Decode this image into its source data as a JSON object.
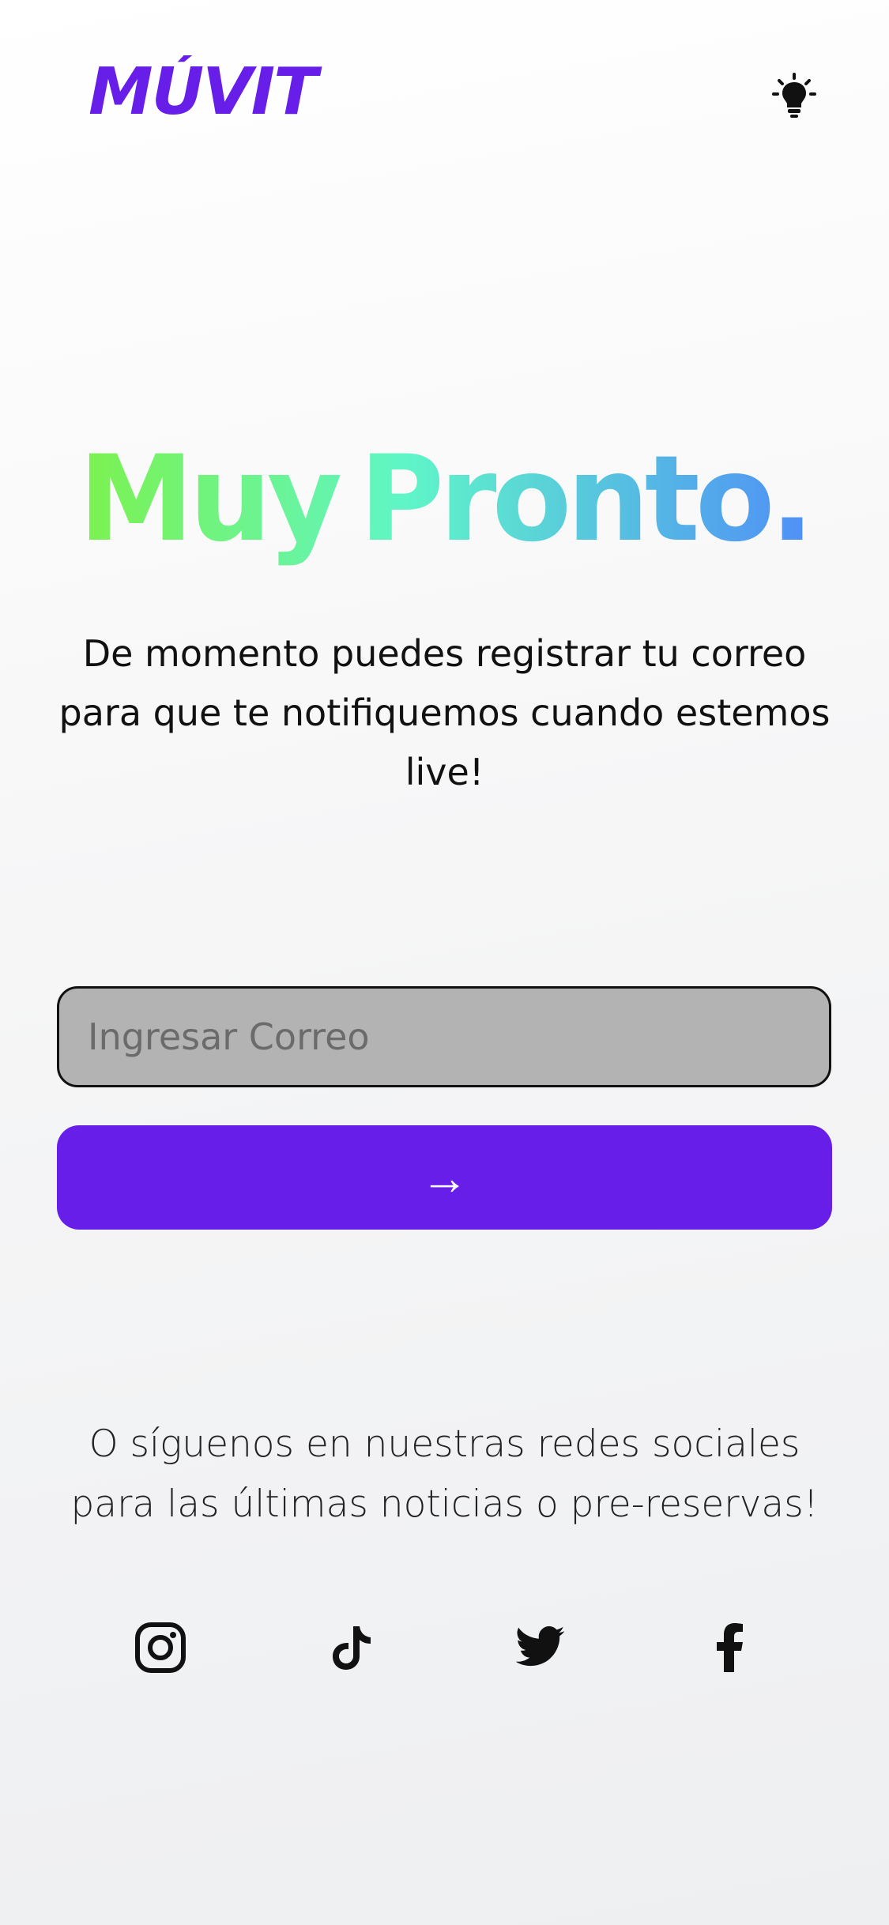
{
  "header": {
    "logo_text": "MÚVIT",
    "theme_toggle_icon": "lightbulb-icon"
  },
  "hero": {
    "title_word1": "Muy",
    "title_word2": "Pronto.",
    "gradient_colors": [
      "#7cf24e",
      "#5ff5c8",
      "#4f8ff7"
    ]
  },
  "subtitle": "De momento puedes registrar tu correo para que te notifiquemos cuando estemos live!",
  "form": {
    "email_placeholder": "Ingresar Correo",
    "email_value": "",
    "submit_label": "→",
    "submit_color": "#661ee8"
  },
  "social": {
    "text": "O síguenos en nuestras redes sociales para las últimas noticias o pre-reservas!",
    "icons": [
      "instagram-icon",
      "tiktok-icon",
      "twitter-icon",
      "facebook-icon"
    ]
  },
  "colors": {
    "brand": "#661ee8",
    "input_bg": "#b3b3b3"
  }
}
